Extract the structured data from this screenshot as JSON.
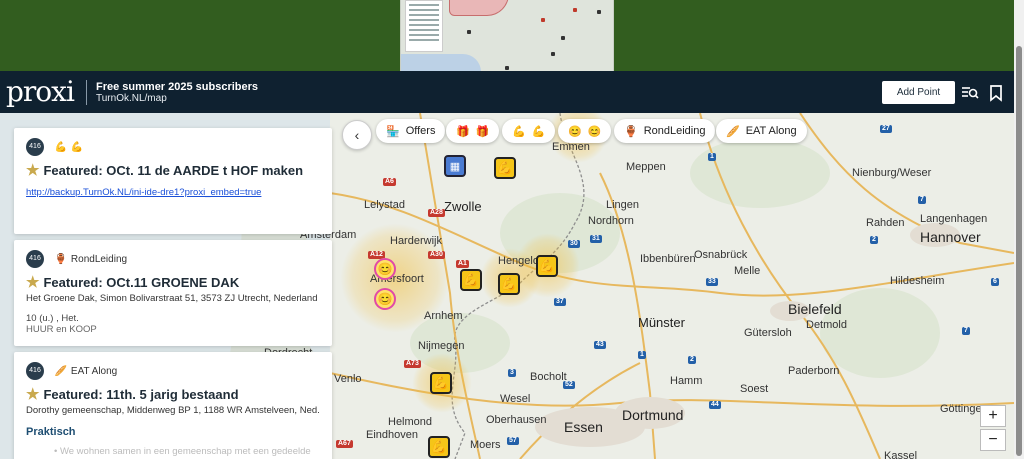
{
  "header": {
    "logo": "proxi",
    "title": "Free summer 2025 subscribers",
    "subtitle": "TurnOk.NL/map",
    "add_point_label": "Add Point",
    "icons": [
      "search-list-icon",
      "bookmark-icon"
    ]
  },
  "filters": [
    {
      "label": "Offers",
      "icon": "🏪"
    },
    {
      "label": "",
      "icon": "🎁"
    },
    {
      "label": "",
      "icon": "💪"
    },
    {
      "label": "",
      "icon": "😊"
    },
    {
      "label": "RondLeiding",
      "icon": "🏺"
    },
    {
      "label": "EAT Along",
      "icon": "🥖"
    }
  ],
  "cards": [
    {
      "count": "416",
      "category": "💪",
      "title": "Featured: OCt. 11 de AARDE t HOF maken",
      "link": "http://backup.TurnOk.NL/ini-ide-dre1?proxi_embed=true"
    },
    {
      "count": "416",
      "category": "RondLeiding",
      "category_icon": "🏺",
      "title": "Featured: OCt.11 GROENE DAK",
      "address": "Het Groene Dak, Simon Bolivarstraat 51, 3573 ZJ Utrecht, Nederland",
      "detail": "10 (u.) , Het.",
      "tags": "HUUR en KOOP"
    },
    {
      "count": "416",
      "category": "EAT Along",
      "category_icon": "🥖",
      "title": "Featured: 11th. 5 jarig bestaand",
      "address": "Dorothy gemeenschap, Middenweg BP 1, 1188 WR Amstelveen, Ned...",
      "section": "Praktisch",
      "bullet": "• We wohnen samen in een gemeenschap met een gedeelde"
    }
  ],
  "map": {
    "cities": [
      {
        "name": "Emmen"
      },
      {
        "name": "Meppen"
      },
      {
        "name": "Nienburg/Weser"
      },
      {
        "name": "Lelystad"
      },
      {
        "name": "Zwolle"
      },
      {
        "name": "Lingen"
      },
      {
        "name": "Rahden"
      },
      {
        "name": "Langenhagen"
      },
      {
        "name": "Nordhorn"
      },
      {
        "name": "Hannover"
      },
      {
        "name": "Harderwijk"
      },
      {
        "name": "Hengelo"
      },
      {
        "name": "Osnabrück"
      },
      {
        "name": "Ibbenbüren"
      },
      {
        "name": "Melle"
      },
      {
        "name": "Hildesheim"
      },
      {
        "name": "Amersfoort"
      },
      {
        "name": "Arnhem"
      },
      {
        "name": "Münster"
      },
      {
        "name": "Bielefeld"
      },
      {
        "name": "Gütersloh"
      },
      {
        "name": "Detmold"
      },
      {
        "name": "Nijmegen"
      },
      {
        "name": "Hamm"
      },
      {
        "name": "Paderborn"
      },
      {
        "name": "Dortmund"
      },
      {
        "name": "Oberhausen"
      },
      {
        "name": "Essen"
      },
      {
        "name": "Eindhoven"
      },
      {
        "name": "Helmond"
      },
      {
        "name": "Göttinge"
      },
      {
        "name": "Kassel"
      },
      {
        "name": "Amsterdam"
      },
      {
        "name": "Dordrecht"
      },
      {
        "name": "Venlo"
      },
      {
        "name": "Bocholt"
      },
      {
        "name": "Wesel"
      },
      {
        "name": "Soest"
      },
      {
        "name": "Moers"
      }
    ],
    "roads": [
      "A6",
      "A28",
      "A1",
      "A30",
      "A12",
      "A73",
      "A67",
      "30",
      "31",
      "33",
      "37",
      "43",
      "52",
      "57",
      "44",
      "1",
      "2",
      "3",
      "27",
      "7",
      "6",
      "1",
      "2",
      "7"
    ],
    "zoom_in": "+",
    "zoom_out": "−"
  },
  "colors": {
    "header_bg": "#0f2130",
    "top_green": "#325d1f",
    "accent_link": "#1a4fd8",
    "badge_bg": "#2a3d4c",
    "marker_glow": "#f2be3c"
  }
}
